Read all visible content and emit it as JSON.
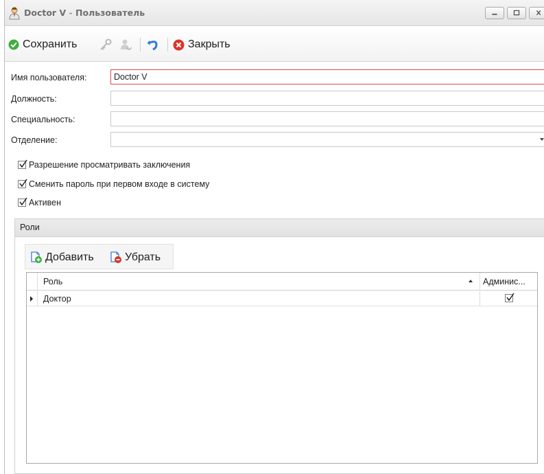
{
  "window": {
    "title_name": "Doctor V",
    "title_separator": " - ",
    "title_context": "Пользователь",
    "icon": "user-icon",
    "controls": [
      "minimize-icon",
      "maximize-icon",
      "close-icon"
    ]
  },
  "toolbar": {
    "save_label": "Сохранить",
    "save_icon": "check-circle-icon",
    "disabled_icons": [
      "key-icon",
      "user-sync-icon"
    ],
    "undo_icon": "undo-icon",
    "close_label": "Закрыть",
    "close_icon": "cancel-circle-icon"
  },
  "form": {
    "username_label": "Имя пользователя:",
    "username_value": "Doctor V",
    "position_label": "Должность:",
    "position_value": "",
    "specialty_label": "Специальность:",
    "specialty_value": "",
    "department_label": "Отделение:",
    "department_value": ""
  },
  "checks": [
    {
      "label": "Разрешение просматривать заключения",
      "checked": true
    },
    {
      "label": "Сменить пароль при первом входе в систему",
      "checked": true
    },
    {
      "label": "Активен",
      "checked": true
    }
  ],
  "roles": {
    "group_title": "Роли",
    "add_label": "Добавить",
    "add_icon": "add-page-icon",
    "remove_label": "Убрать",
    "remove_icon": "remove-page-icon",
    "columns": [
      "Роль",
      "Админис..."
    ],
    "rows": [
      {
        "role": "Доктор",
        "admin": true
      }
    ]
  },
  "colors": {
    "error_border": "#d44c4c",
    "save_green": "#3fae3f",
    "close_red": "#d9352b",
    "undo_blue": "#2f78d6"
  }
}
